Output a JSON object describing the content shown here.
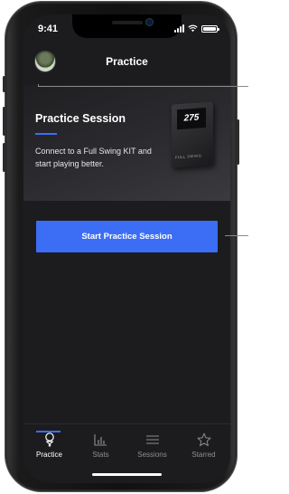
{
  "status_bar": {
    "time": "9:41"
  },
  "header": {
    "title": "Practice"
  },
  "practice_card": {
    "title": "Practice Session",
    "description": "Connect to a Full Swing KIT and start playing better.",
    "device_display_value": "275",
    "device_brand": "FULL SWING"
  },
  "start_button": {
    "label": "Start Practice Session"
  },
  "tabs": [
    {
      "label": "Practice",
      "icon": "golf-tee-icon",
      "active": true
    },
    {
      "label": "Stats",
      "icon": "bar-chart-icon",
      "active": false
    },
    {
      "label": "Sessions",
      "icon": "list-icon",
      "active": false
    },
    {
      "label": "Starred",
      "icon": "star-icon",
      "active": false
    }
  ],
  "colors": {
    "accent": "#3b6ef5",
    "background": "#1c1c1e"
  }
}
